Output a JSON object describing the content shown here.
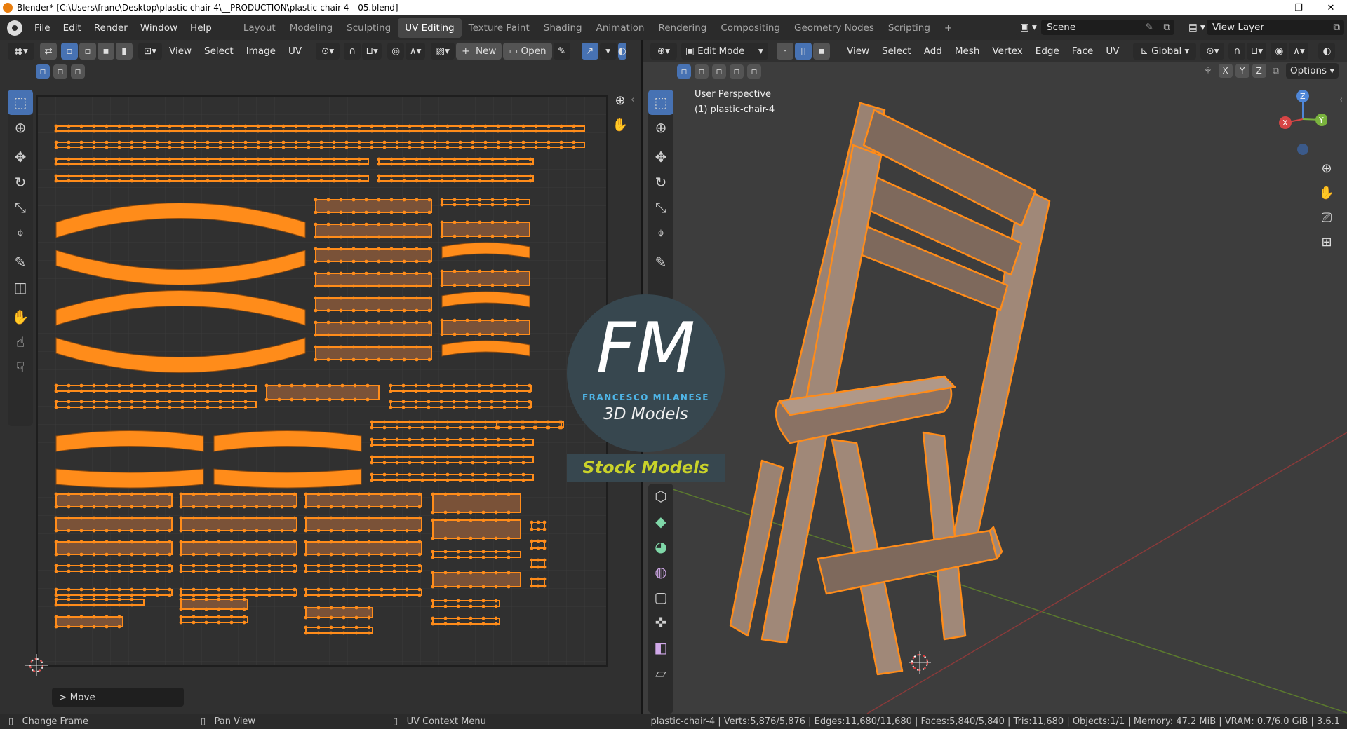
{
  "window": {
    "title": "Blender* [C:\\Users\\franc\\Desktop\\plastic-chair-4\\__PRODUCTION\\plastic-chair-4---05.blend]",
    "minimize": "—",
    "maximize": "❐",
    "close": "✕"
  },
  "menu": [
    "File",
    "Edit",
    "Render",
    "Window",
    "Help"
  ],
  "workspaces": [
    "Layout",
    "Modeling",
    "Sculpting",
    "UV Editing",
    "Texture Paint",
    "Shading",
    "Animation",
    "Rendering",
    "Compositing",
    "Geometry Nodes",
    "Scripting"
  ],
  "active_workspace": "UV Editing",
  "add_workspace": "+",
  "scene": {
    "label": "Scene"
  },
  "view_layer": {
    "label": "View Layer"
  },
  "uv_editor": {
    "menus": [
      "View",
      "Select",
      "Image",
      "UV"
    ],
    "new_label": "New",
    "new_plus": "+",
    "open_label": "Open",
    "last_operator": "Move",
    "last_operator_chevron": ">"
  },
  "viewport": {
    "mode": "Edit Mode",
    "menus": [
      "View",
      "Select",
      "Add",
      "Mesh",
      "Vertex",
      "Edge",
      "Face",
      "UV"
    ],
    "transform_orientation": "Global",
    "axes": [
      "X",
      "Y",
      "Z"
    ],
    "options_label": "Options",
    "view_name": "User Perspective",
    "object_name": "(1) plastic-chair-4",
    "gizmo": {
      "x": "X",
      "y": "Y",
      "z": "Z"
    }
  },
  "watermark": {
    "initials": "FM",
    "company": "FRANCESCO MILANESE",
    "subtitle": "3D Models",
    "banner": "Stock Models"
  },
  "status": {
    "left": [
      {
        "icon": "mouse-left-icon",
        "label": "Change Frame"
      },
      {
        "icon": "mouse-middle-icon",
        "label": "Pan View"
      },
      {
        "icon": "mouse-right-icon",
        "label": "UV Context Menu"
      }
    ],
    "stats": "plastic-chair-4 | Verts:5,876/5,876 | Edges:11,680/11,680 | Faces:5,840/5,840 | Tris:11,680 | Objects:1/1 | Memory: 47.2 MiB | VRAM: 0.7/6.0 GiB | 3.6.1"
  },
  "colors": {
    "accent_blue": "#4772b3",
    "selection_orange": "#ff8c1a",
    "face_fill": "#7a5238",
    "panel_bg": "#303030",
    "header_bg": "#2b2b2b"
  }
}
